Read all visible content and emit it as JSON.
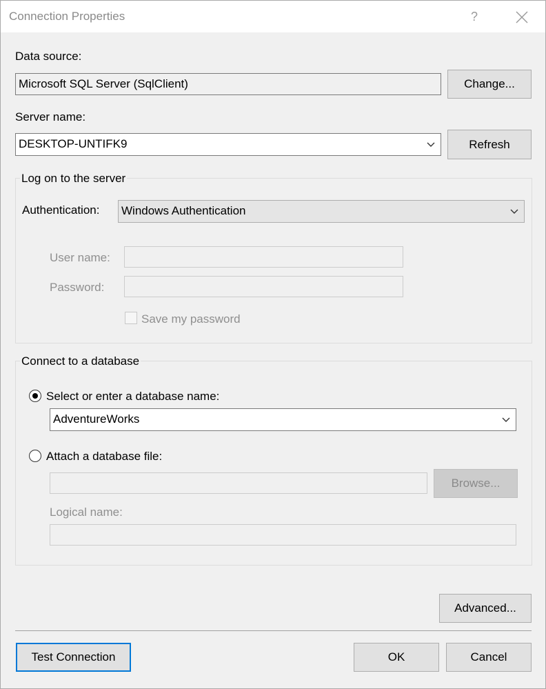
{
  "window": {
    "title": "Connection Properties",
    "help_glyph": "?"
  },
  "data_source": {
    "label": "Data source:",
    "value": "Microsoft SQL Server (SqlClient)",
    "change_button": "Change..."
  },
  "server": {
    "label": "Server name:",
    "value": "DESKTOP-UNTIFK9",
    "refresh_button": "Refresh"
  },
  "logon": {
    "group_title": "Log on to the server",
    "auth_label": "Authentication:",
    "auth_value": "Windows Authentication",
    "user_label": "User name:",
    "user_value": "",
    "password_label": "Password:",
    "password_value": "",
    "save_password_label": "Save my password",
    "save_password_checked": false
  },
  "database": {
    "group_title": "Connect to a database",
    "select_option_label": "Select or enter a database name:",
    "select_option_selected": true,
    "database_name_value": "AdventureWorks",
    "attach_option_label": "Attach a database file:",
    "attach_option_selected": false,
    "attach_file_value": "",
    "browse_button": "Browse...",
    "logical_name_label": "Logical name:",
    "logical_name_value": ""
  },
  "footer": {
    "advanced_button": "Advanced...",
    "test_connection_button": "Test Connection",
    "ok_button": "OK",
    "cancel_button": "Cancel"
  },
  "colors": {
    "accent_focus": "#0078d7",
    "dialog_background": "#f0f0f0",
    "disabled_text": "#8f8f8f"
  },
  "icons": {
    "close": "close-icon",
    "dropdown": "chevron-down-icon",
    "help": "help-icon"
  }
}
